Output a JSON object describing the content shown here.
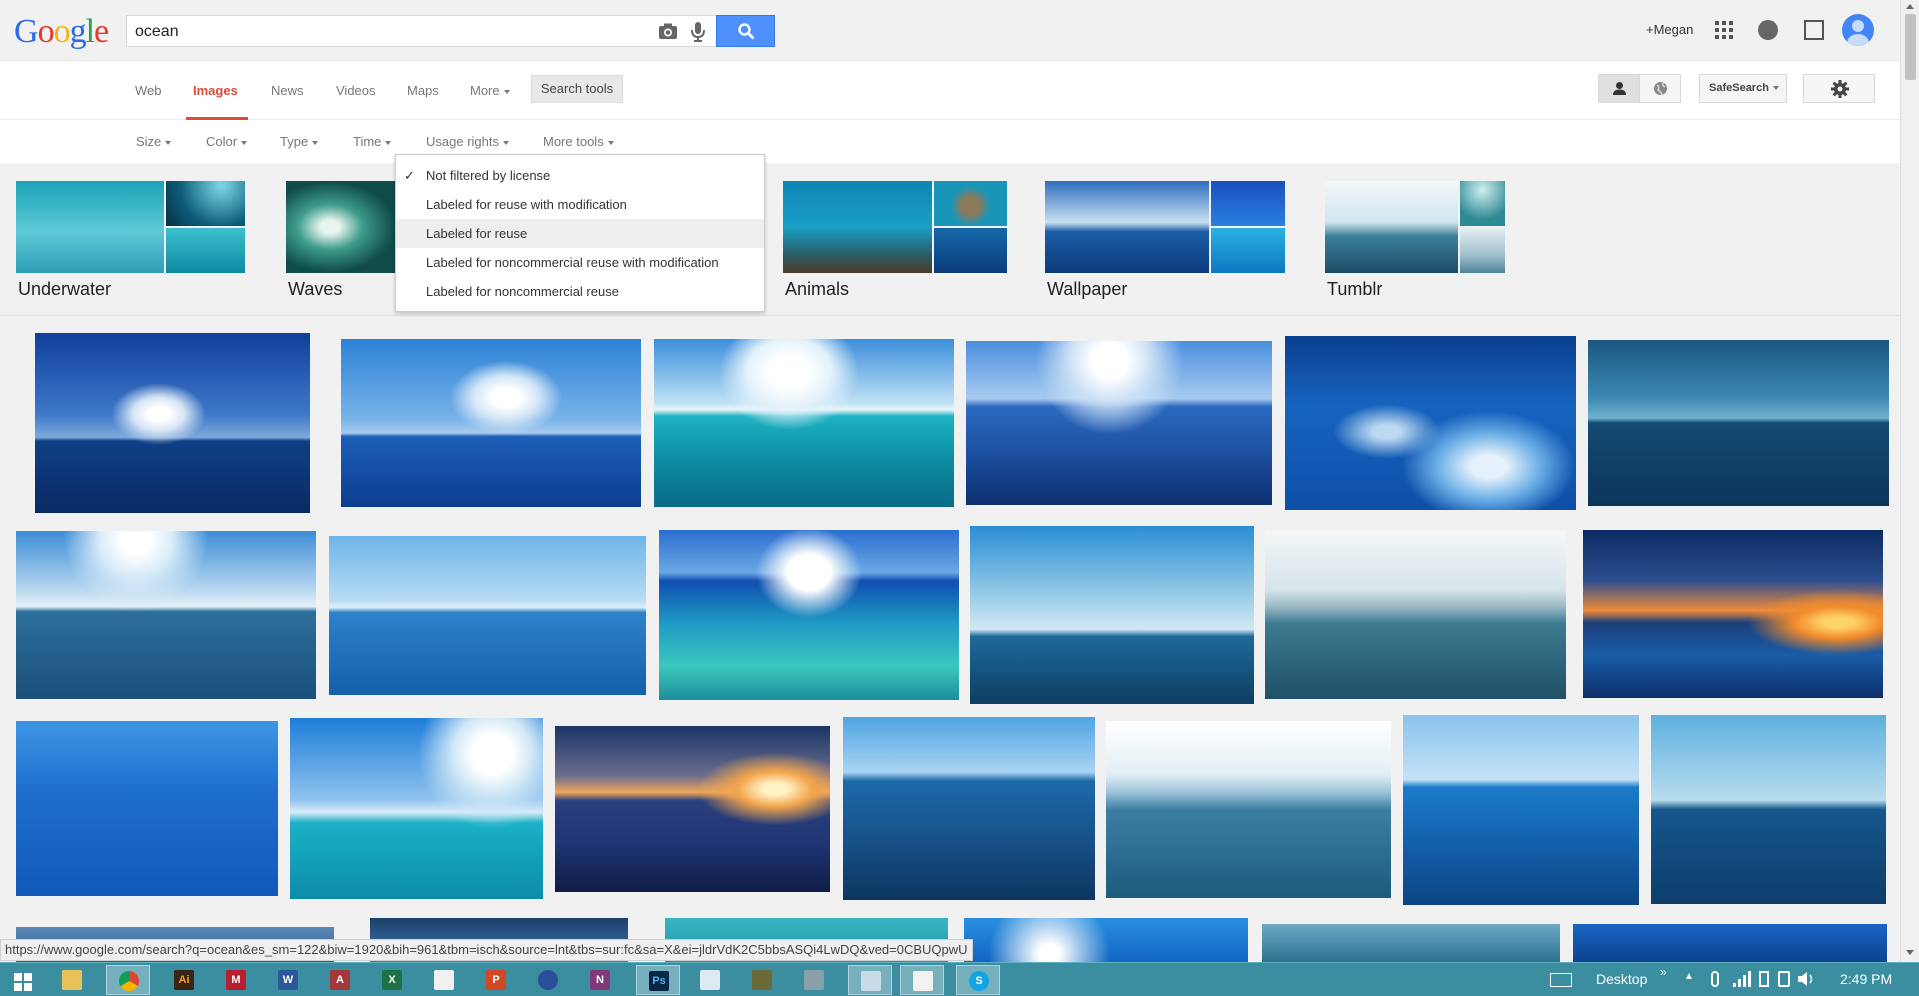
{
  "logo": {
    "letters": [
      "G",
      "o",
      "o",
      "g",
      "l",
      "e"
    ],
    "colors": [
      "#2a6ae6",
      "#e23b2a",
      "#f2b417",
      "#2a6ae6",
      "#2aa048",
      "#e23b2a"
    ]
  },
  "search": {
    "value": "ocean"
  },
  "header": {
    "user_link": "+Megan"
  },
  "nav": {
    "tabs": [
      "Web",
      "Images",
      "News",
      "Videos",
      "Maps",
      "More"
    ],
    "search_tools": "Search tools",
    "safesearch": "SafeSearch"
  },
  "tools": [
    "Size",
    "Color",
    "Type",
    "Time",
    "Usage rights",
    "More tools"
  ],
  "usage_rights_menu": {
    "items": [
      "Not filtered by license",
      "Labeled for reuse with modification",
      "Labeled for reuse",
      "Labeled for noncommercial reuse with modification",
      "Labeled for noncommercial reuse"
    ],
    "checked": "Not filtered by license",
    "highlighted": "Labeled for reuse"
  },
  "related": [
    "Underwater",
    "Waves",
    "Animals",
    "Wallpaper",
    "Tumblr"
  ],
  "statusbar": {
    "url": "https://www.google.com/search?q=ocean&es_sm=122&biw=1920&bih=961&tbm=isch&source=lnt&tbs=sur:fc&sa=X&ei=jldrVdK2C5bbsASQi4LwDQ&ved=0CBUQpwU"
  },
  "taskbar": {
    "apps": [
      "Ai",
      "M",
      "W",
      "A",
      "X",
      "",
      "P",
      "",
      "N",
      "Ps",
      "",
      "",
      "",
      "",
      "",
      "S"
    ],
    "desktop_label": "Desktop",
    "clock": "2:49 PM"
  },
  "colors": {
    "accent": "#dd4b39",
    "search_button": "#4d90fe",
    "taskbar": "#3b8ea0"
  }
}
